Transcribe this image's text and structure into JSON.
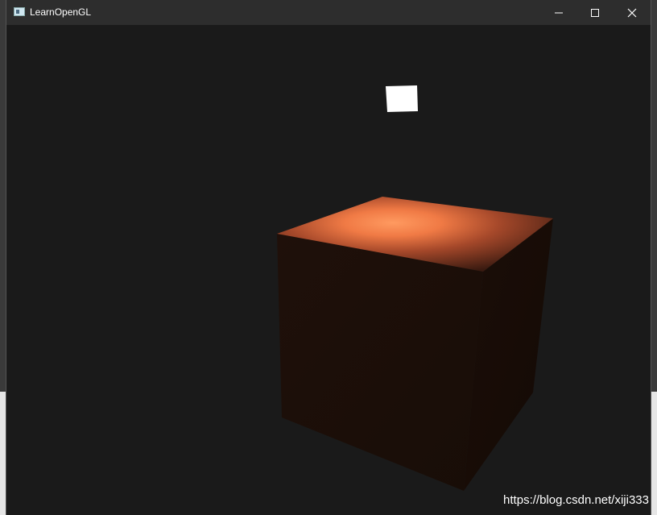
{
  "window": {
    "title": "LearnOpenGL",
    "icon": "app-window-icon",
    "controls": {
      "minimize": "minimize-icon",
      "maximize": "maximize-icon",
      "close": "close-icon"
    }
  },
  "scene": {
    "background_color": "#1a1a1a",
    "light_color": "#ffffff",
    "cube_top_highlight": "#ff8a50",
    "cube_side_color": "#1c0f09"
  },
  "watermark": {
    "text": "https://blog.csdn.net/xiji333"
  }
}
